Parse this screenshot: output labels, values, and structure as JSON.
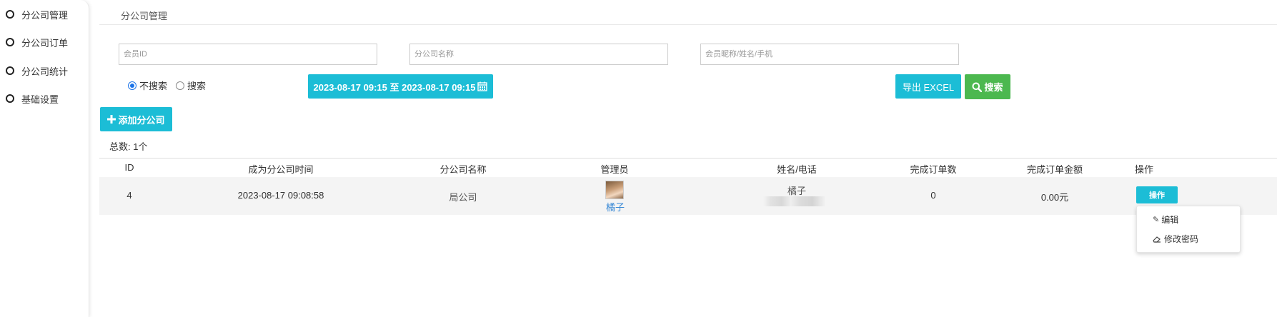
{
  "sidebar": {
    "items": [
      {
        "label": "分公司管理"
      },
      {
        "label": "分公司订单"
      },
      {
        "label": "分公司统计"
      },
      {
        "label": "基础设置"
      }
    ]
  },
  "breadcrumb": "分公司管理",
  "filters": {
    "member_id_placeholder": "会员ID",
    "branch_name_placeholder": "分公司名称",
    "member_info_placeholder": "会员昵称/姓名/手机",
    "radio_no_search": "不搜索",
    "radio_search": "搜索",
    "radio_selected": "不搜索",
    "date_range": "2023-08-17 09:15 至 2023-08-17 09:15"
  },
  "buttons": {
    "export": "导出 EXCEL",
    "search": "搜索",
    "add_branch": "添加分公司"
  },
  "total_label": "总数: 1个",
  "table": {
    "headers": [
      "ID",
      "成为分公司时间",
      "分公司名称",
      "管理员",
      "姓名/电话",
      "完成订单数",
      "完成订单金额",
      "操作"
    ],
    "rows": [
      {
        "id": "4",
        "time": "2023-08-17 09:08:58",
        "branch_name": "局公司",
        "admin": "橘子",
        "name": "橘子",
        "orders": "0",
        "amount": "0.00元",
        "action": "操作"
      }
    ]
  },
  "dropdown": {
    "items": [
      {
        "icon": "pencil-icon",
        "label": "编辑"
      },
      {
        "icon": "eraser-icon",
        "label": "修改密码"
      }
    ]
  },
  "colors": {
    "accent": "#1cbdd6",
    "success": "#4cb84f",
    "link": "#3b8ad6"
  }
}
